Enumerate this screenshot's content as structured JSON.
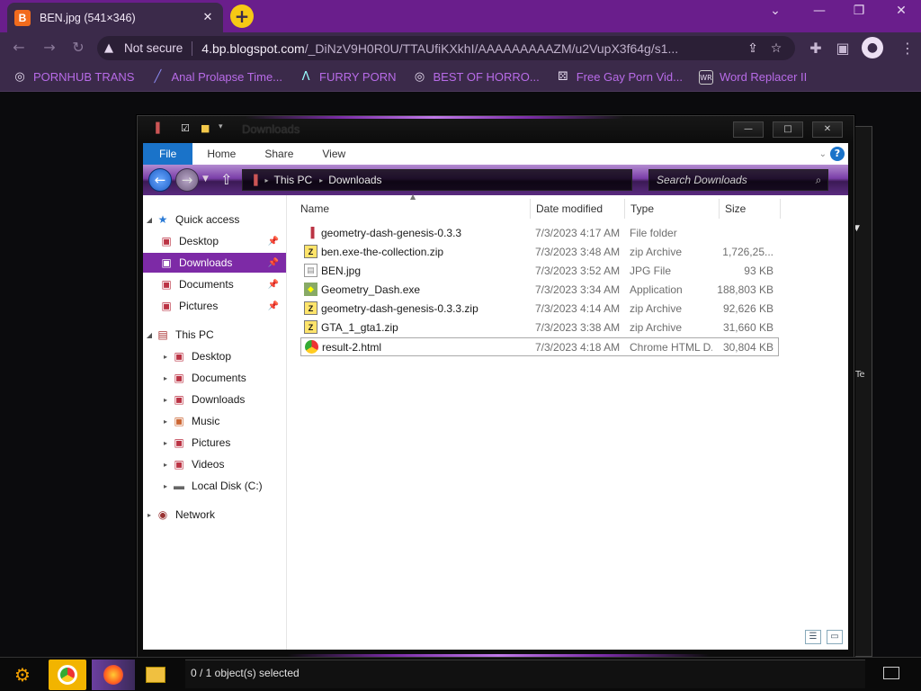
{
  "browser": {
    "tab_title": "BEN.jpg (541×346)",
    "tab_favicon_letter": "B",
    "new_tab_icon": "+",
    "security_label": "Not secure",
    "url_host": "4.bp.blogspot.com",
    "url_path": "/_DiNzV9H0R0U/TTAUfiKXkhI/AAAAAAAAAZM/u2VupX3f64g/s1...",
    "bookmarks": [
      {
        "icon": "circle-icon",
        "label": "PORNHUB TRANS"
      },
      {
        "icon": "chart-icon",
        "label": "Anal Prolapse Time..."
      },
      {
        "icon": "lambda-icon",
        "label": "FURRY PORN"
      },
      {
        "icon": "circle-icon",
        "label": "BEST OF HORRO..."
      },
      {
        "icon": "dice-icon",
        "label": "Free Gay Porn Vid..."
      },
      {
        "icon": "wr-icon",
        "label": "Word Replacer II"
      }
    ],
    "colors": {
      "tabbar": "#6a1e8c",
      "toolbar": "#3b2a4a",
      "bookmark_text": "#b86be8"
    }
  },
  "explorer": {
    "title": "Downloads",
    "ribbon_tabs": [
      "File",
      "Home",
      "Share",
      "View"
    ],
    "path": [
      "This PC",
      "Downloads"
    ],
    "search_placeholder": "Search Downloads",
    "nav": {
      "quick_access": "Quick access",
      "quick_items": [
        "Desktop",
        "Downloads",
        "Documents",
        "Pictures"
      ],
      "this_pc": "This PC",
      "pc_items": [
        "Desktop",
        "Documents",
        "Downloads",
        "Music",
        "Pictures",
        "Videos",
        "Local Disk (C:)"
      ],
      "network": "Network"
    },
    "columns": [
      "Name",
      "Date modified",
      "Type",
      "Size"
    ],
    "files": [
      {
        "name": "geometry-dash-genesis-0.3.3",
        "date": "7/3/2023 4:17 AM",
        "type": "File folder",
        "size": "",
        "icon": "folder-icon"
      },
      {
        "name": "ben.exe-the-collection.zip",
        "date": "7/3/2023 3:48 AM",
        "type": "zip Archive",
        "size": "1,726,25...",
        "icon": "zip-icon"
      },
      {
        "name": "BEN.jpg",
        "date": "7/3/2023 3:52 AM",
        "type": "JPG File",
        "size": "93 KB",
        "icon": "image-icon"
      },
      {
        "name": "Geometry_Dash.exe",
        "date": "7/3/2023 3:34 AM",
        "type": "Application",
        "size": "188,803 KB",
        "icon": "app-icon"
      },
      {
        "name": "geometry-dash-genesis-0.3.3.zip",
        "date": "7/3/2023 4:14 AM",
        "type": "zip Archive",
        "size": "92,626 KB",
        "icon": "zip-icon"
      },
      {
        "name": "GTA_1_gta1.zip",
        "date": "7/3/2023 3:38 AM",
        "type": "zip Archive",
        "size": "31,660 KB",
        "icon": "zip-icon"
      },
      {
        "name": "result-2.html",
        "date": "7/3/2023 4:18 AM",
        "type": "Chrome HTML D...",
        "size": "30,804 KB",
        "icon": "chrome-icon"
      }
    ],
    "status": "0 / 1 object(s) selected",
    "accent": "#7d2aa6"
  }
}
